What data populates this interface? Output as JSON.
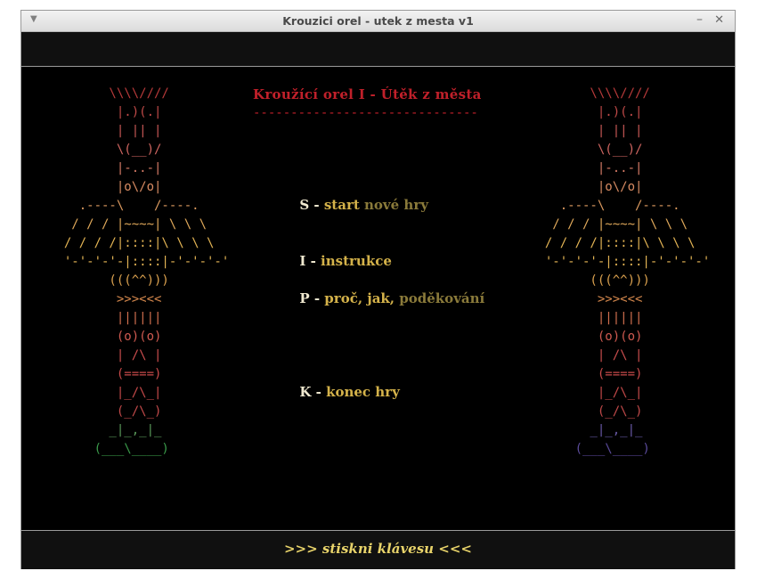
{
  "window": {
    "title": "Krouzici orel - utek z mesta v1",
    "minimize_glyph": "–",
    "close_glyph": "✕",
    "menu_glyph": "▼"
  },
  "heading": {
    "title": "Kroužící orel I - Útěk z města",
    "rule": "------------------------------"
  },
  "menu": [
    {
      "key": "S",
      "sep": " - ",
      "label_a": "start ",
      "label_b": "nové hry"
    },
    {
      "key": "I",
      "sep": " - ",
      "label_a": "instrukce",
      "label_b": ""
    },
    {
      "key": "P",
      "sep": " - ",
      "label_a": "proč, jak, ",
      "label_b": "poděkování"
    },
    {
      "key": "K",
      "sep": " - ",
      "label_a": "konec hry",
      "label_b": ""
    }
  ],
  "prompt": ">>> stiskni klávesu <<<",
  "totem_lines": [
    "        \\\\\\\\////",
    "         |.)(.|",
    "         | || |",
    "         \\(__)/",
    "         |-..-|",
    "         |o\\/o|",
    "    .----\\    /----.",
    "   / / / |~~~~| \\ \\ \\",
    "  / / / /|::::|\\ \\ \\ \\",
    "  '-'-'-'-|::::|-'-'-'-'",
    "        (((^^)))",
    "         >>><<<",
    "         ||||||",
    "         (o)(o)",
    "         | /\\ |",
    "         (====)",
    "         |_/\\_|",
    "         (_/\\_)",
    "        _|_,_|_",
    "      (___\\____)"
  ],
  "colors": {
    "heading": "#c0202a",
    "prompt": "#e8d36a",
    "totem_gradient": [
      "#b83a3a",
      "#c04a48",
      "#c85856",
      "#cf6560",
      "#d77b66",
      "#d98c63",
      "#dc9a5f",
      "#dfa85a",
      "#e3b454",
      "#e3b454",
      "#dca24f",
      "#d88a4e",
      "#d4704f",
      "#d05a50",
      "#cc4e4e",
      "#c84a4a",
      "#c64a4a",
      "#c24a4a",
      "#5a9a5a",
      "#3a9a4a"
    ],
    "right_base_color": [
      "#6a5aa8",
      "#5a4a9a"
    ]
  }
}
